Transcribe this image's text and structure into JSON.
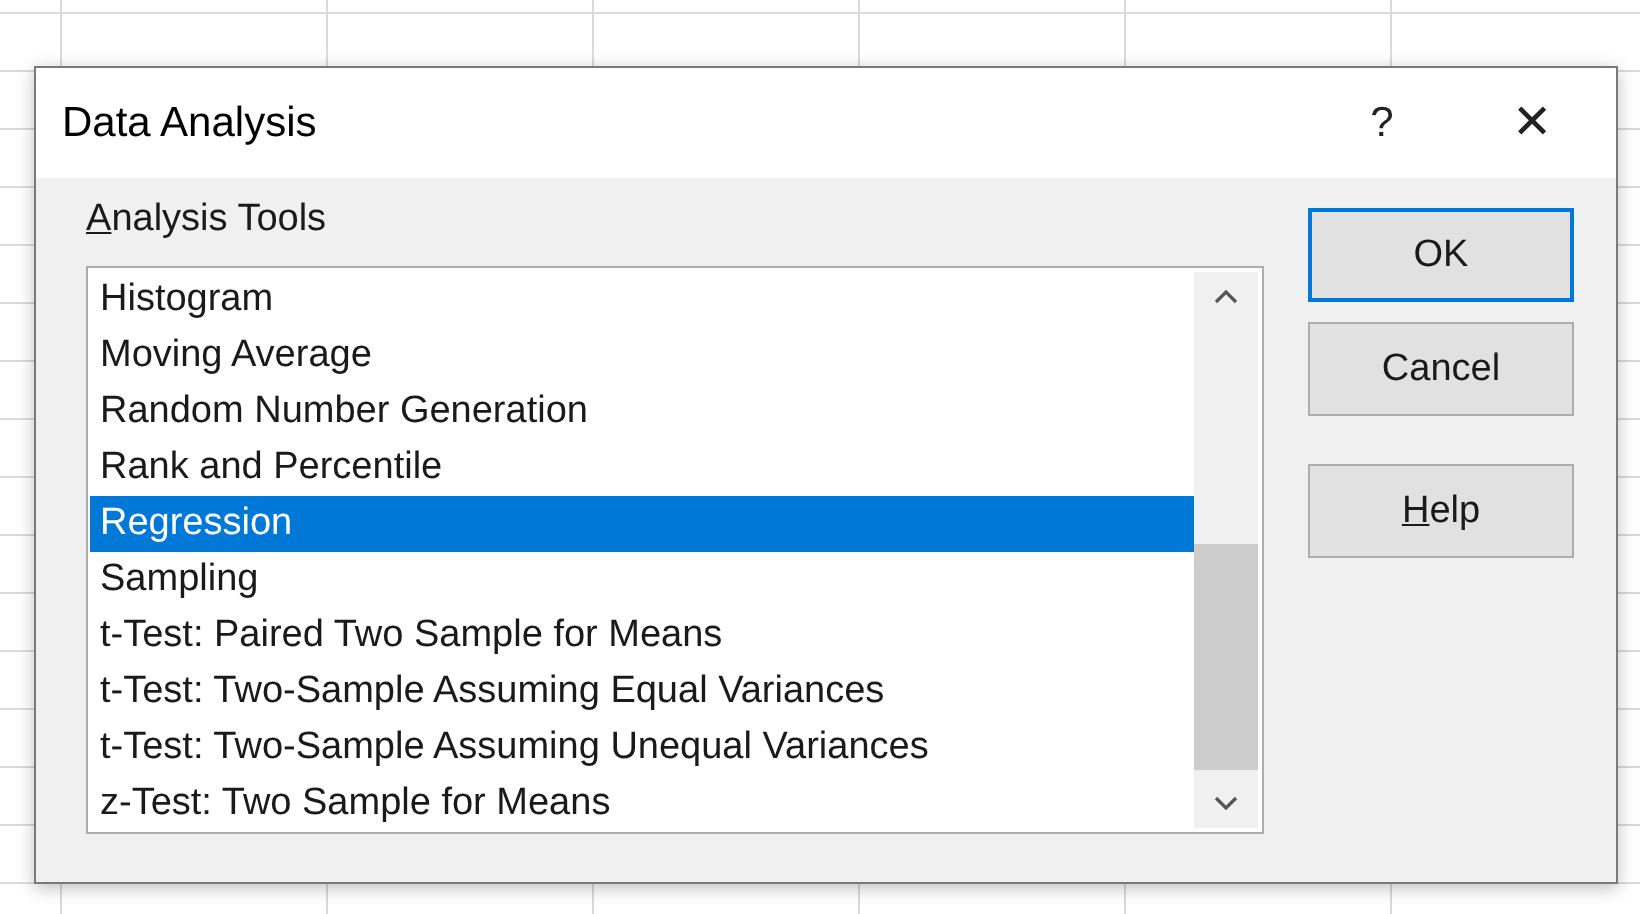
{
  "window": {
    "title": "Data Analysis",
    "help_glyph": "?",
    "close_glyph": "✕"
  },
  "label": {
    "text": "Analysis Tools",
    "mnemonic_underlined": true
  },
  "tools": [
    {
      "label": "Histogram",
      "selected": false
    },
    {
      "label": "Moving Average",
      "selected": false
    },
    {
      "label": "Random Number Generation",
      "selected": false
    },
    {
      "label": "Rank and Percentile",
      "selected": false
    },
    {
      "label": "Regression",
      "selected": true
    },
    {
      "label": "Sampling",
      "selected": false
    },
    {
      "label": "t-Test: Paired Two Sample for Means",
      "selected": false
    },
    {
      "label": "t-Test: Two-Sample Assuming Equal Variances",
      "selected": false
    },
    {
      "label": "t-Test: Two-Sample Assuming Unequal Variances",
      "selected": false
    },
    {
      "label": "z-Test: Two Sample for Means",
      "selected": false
    }
  ],
  "buttons": [
    {
      "label": "OK",
      "default": true,
      "mnemonic_underlined": false
    },
    {
      "label": "Cancel",
      "default": false,
      "mnemonic_underlined": false
    },
    {
      "label": "Help",
      "default": false,
      "mnemonic_underlined": true
    }
  ]
}
